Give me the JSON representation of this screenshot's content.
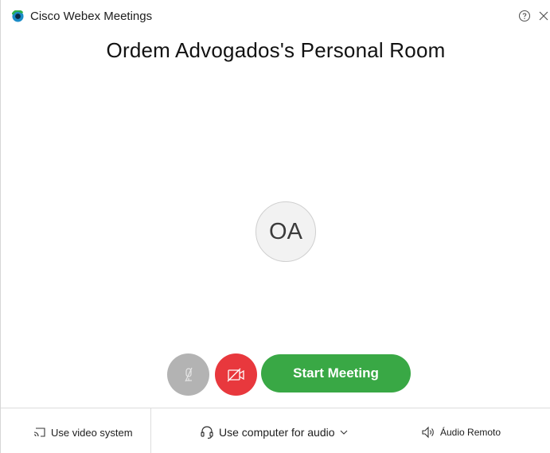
{
  "window": {
    "title": "Cisco Webex Meetings"
  },
  "room": {
    "title": "Ordem Advogados's Personal Room",
    "avatar_initials": "OA"
  },
  "controls": {
    "start_meeting_label": "Start Meeting"
  },
  "bottom_bar": {
    "video_system_label": "Use video system",
    "audio_connect_label": "Use computer for audio",
    "remote_audio_label": "Áudio Remoto"
  },
  "colors": {
    "start_button": "#39a845",
    "video_off": "#e8383d",
    "mute_disabled": "#b3b3b3"
  },
  "icons": {
    "app": "webex-logo-icon",
    "help": "help-icon",
    "close": "close-icon",
    "mute": "microphone-muted-icon",
    "video": "video-off-icon",
    "video_system": "cast-icon",
    "audio": "headset-icon",
    "dropdown": "chevron-down-icon",
    "speaker": "speaker-icon"
  }
}
